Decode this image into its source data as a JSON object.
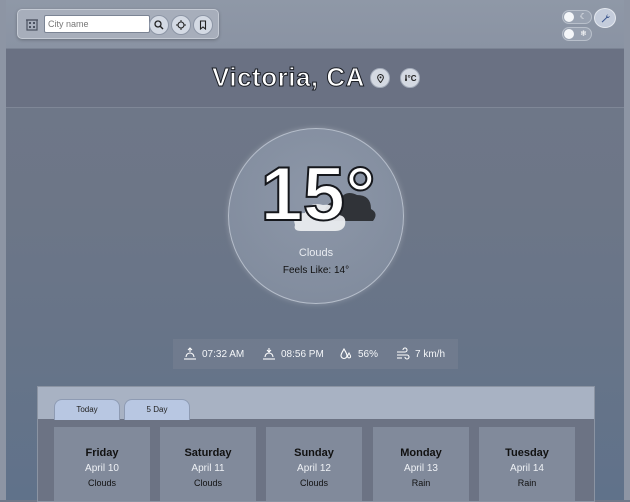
{
  "search": {
    "placeholder": "City name"
  },
  "header": {
    "city": "Victoria, CA",
    "unit_label": "°C"
  },
  "current": {
    "temperature": "15°",
    "condition": "Clouds",
    "feels_like": "Feels Like: 14°"
  },
  "stats": {
    "sunrise": "07:32 AM",
    "sunset": "08:56 PM",
    "humidity": "56%",
    "wind": "7 km/h"
  },
  "tabs": [
    {
      "label": "Today"
    },
    {
      "label": "5 Day"
    }
  ],
  "forecast": [
    {
      "day": "Friday",
      "date": "April 10",
      "condition": "Clouds"
    },
    {
      "day": "Saturday",
      "date": "April 11",
      "condition": "Clouds"
    },
    {
      "day": "Sunday",
      "date": "April 12",
      "condition": "Clouds"
    },
    {
      "day": "Monday",
      "date": "April 13",
      "condition": "Rain"
    },
    {
      "day": "Tuesday",
      "date": "April 14",
      "condition": "Rain"
    }
  ],
  "icons": {
    "search": "building-icon",
    "buttons": [
      "search-icon",
      "locate-icon",
      "bookmark-icon"
    ],
    "theme_toggle": "moon-icon",
    "units_toggle": "snowflake-icon",
    "settings": "wrench-icon",
    "header": [
      "location-pin-icon",
      "thermometer-icon"
    ],
    "weather": "cloud-icon",
    "stats": [
      "sunrise-icon",
      "sunset-icon",
      "humidity-icon",
      "wind-icon"
    ]
  },
  "colors": {
    "accent": "#b8c7e2",
    "title_text": "#ffffff"
  }
}
